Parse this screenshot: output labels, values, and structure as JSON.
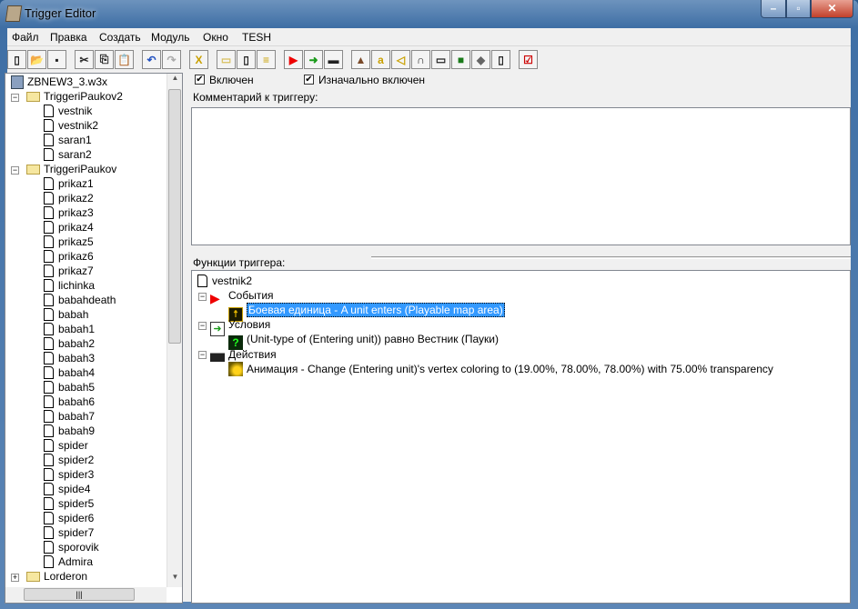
{
  "window": {
    "title": "Trigger Editor",
    "controls": [
      "minimize",
      "maximize",
      "close"
    ]
  },
  "menu": [
    "Файл",
    "Правка",
    "Создать",
    "Модуль",
    "Окно",
    "TESH"
  ],
  "toolbar": [
    "new-icon",
    "open-icon",
    "save-icon",
    "cut-icon",
    "copy-icon",
    "paste-icon",
    "undo-icon",
    "redo-icon",
    "delete-x-icon",
    "folder-icon",
    "new-trigger-icon",
    "comment-icon",
    "event-flag-icon",
    "condition-icon",
    "action-clapper-icon",
    "terrain-icon",
    "text-a-icon",
    "sound-icon",
    "ability-icon",
    "item-icon",
    "unit-icon",
    "doodad-icon",
    "import-icon",
    "test-map-icon"
  ],
  "tree": {
    "root": "ZBNEW3_3.w3x",
    "folders": [
      {
        "name": "TriggeriPaukov2",
        "expanded": true,
        "items": [
          "vestnik",
          "vestnik2",
          "saran1",
          "saran2"
        ]
      },
      {
        "name": "TriggeriPaukov",
        "expanded": true,
        "items": [
          "prikaz1",
          "prikaz2",
          "prikaz3",
          "prikaz4",
          "prikaz5",
          "prikaz6",
          "prikaz7",
          "lichinka",
          "babahdeath",
          "babah",
          "babah1",
          "babah2",
          "babah3",
          "babah4",
          "babah5",
          "babah6",
          "babah7",
          "babah9",
          "spider",
          "spider2",
          "spider3",
          "spide4",
          "spider5",
          "spider6",
          "spider7",
          "sporovik",
          "Admira"
        ]
      },
      {
        "name": "Lorderon",
        "expanded": false,
        "items": []
      }
    ]
  },
  "trigger": {
    "enabled_label": "Включен",
    "enabled": true,
    "initially_on_label": "Изначально включен",
    "initially_on": true,
    "comment_label": "Комментарий к триггеру:",
    "comment": "",
    "functions_label": "Функции триггера:",
    "name": "vestnik2",
    "events_label": "События",
    "event": "Боевая единица - A unit enters (Playable map area)",
    "conditions_label": "Условия",
    "condition": "(Unit-type of (Entering unit)) равно Вестник (Пауки)",
    "actions_label": "Действия",
    "action": "Анимация - Change (Entering unit)'s vertex coloring to (19.00%, 78.00%, 78.00%) with 75.00% transparency"
  }
}
